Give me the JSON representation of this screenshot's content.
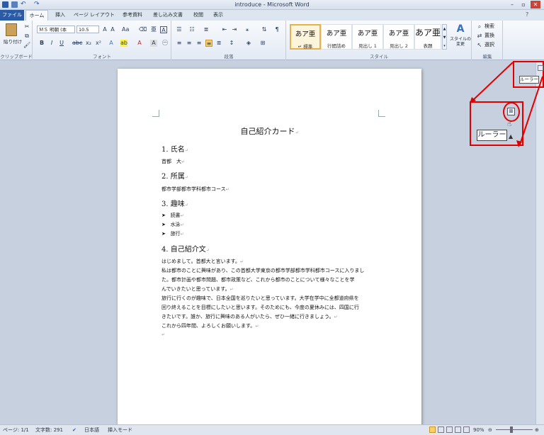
{
  "window": {
    "title": "introduce - Microsoft Word"
  },
  "tabs": {
    "file": "ファイル",
    "home": "ホーム",
    "insert": "挿入",
    "page_layout": "ページ レイアウト",
    "references": "参考資料",
    "mailings": "差し込み文書",
    "review": "校閲",
    "view": "表示"
  },
  "ribbon": {
    "clipboard": {
      "paste": "貼り付け",
      "label": "クリップボード"
    },
    "font": {
      "name": "ＭＳ 明朝 (本",
      "size": "10.5",
      "label": "フォント"
    },
    "paragraph": {
      "label": "段落"
    },
    "styles": {
      "label": "スタイル",
      "items": [
        {
          "sample": "あア亜",
          "name": "↵ 標準"
        },
        {
          "sample": "あア亜",
          "name": "行間詰め"
        },
        {
          "sample": "あア亜",
          "name": "見出し 1"
        },
        {
          "sample": "あア亜",
          "name": "見出し 2"
        },
        {
          "sample": "あア亜",
          "name": "表題"
        }
      ],
      "change": "スタイルの\n変更"
    },
    "editing": {
      "label": "編集",
      "find": "検索",
      "replace": "置換",
      "select": "選択"
    }
  },
  "document": {
    "title": "自己紹介カード",
    "s1_heading": "1.  氏名",
    "s1_text": "首都　大",
    "s2_heading": "2.  所属",
    "s2_text": "都市学部都市学科都市コース",
    "s3_heading": "3.  趣味",
    "hobbies": [
      "読書",
      "水泳",
      "旅行"
    ],
    "s4_heading": "4.  自己紹介文",
    "intro": [
      "はじめまして。首都大と言います。",
      "私は都市のことに興味があり、この首都大学東京の都市学部都市学科都市コースに入りまし",
      "た。都市計画や都市問題、都市政策など、これから都市のことについて様々なことを学",
      "んでいきたいと思っています。",
      "旅行に行くのが趣味で、日本全国を巡りたいと思っています。大学在学中に全都道府県を",
      "回り終えることを目標にしたいと思います。そのためにも、今度の夏休みには、四国に行",
      "きたいです。誰か、旅行に興味のある人がいたら、ぜひ一緒に行きましょう。",
      "これから四年間、よろしくお願いします。"
    ],
    "mark": "↵",
    "bullet": "➤"
  },
  "callout": {
    "label": "ルーラー",
    "small_label": "ルーラー"
  },
  "status": {
    "page": "ページ: 1/1",
    "words": "文字数: 291",
    "language": "日本語",
    "mode": "挿入モード",
    "zoom": "90%"
  }
}
